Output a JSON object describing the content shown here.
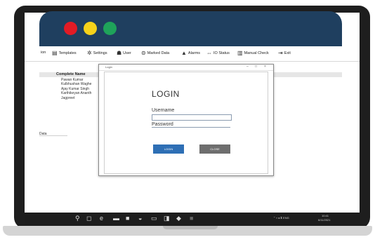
{
  "toolbar": {
    "items": [
      {
        "label": "ion",
        "icon": "app-icon"
      },
      {
        "label": "Templates",
        "icon": "templates-icon"
      },
      {
        "label": "Settings",
        "icon": "gear-icon"
      },
      {
        "label": "User",
        "icon": "users-icon"
      },
      {
        "label": "Marked Data",
        "icon": "marked-data-icon"
      },
      {
        "label": "Alarms",
        "icon": "alarm-bell-icon"
      },
      {
        "label": "IO Status",
        "icon": "io-status-icon"
      },
      {
        "label": "Manual Check",
        "icon": "manual-check-icon"
      },
      {
        "label": "Exit",
        "icon": "exit-icon"
      }
    ]
  },
  "list": {
    "header": "Complete Name",
    "items": [
      "Pawan Kumar",
      "Kulbhushan Waghe",
      "Ajay Kumar Singh",
      "Karthikeyan Ananth",
      "Jagpreet"
    ]
  },
  "side_label": "Data",
  "dialog": {
    "title": "Login",
    "heading": "LOGIN",
    "username_label": "Username",
    "username_value": "",
    "password_label": "Password",
    "password_value": "",
    "login_button": "LOGIN",
    "close_button": "CLOSE"
  },
  "taskbar": {
    "time": "10:41",
    "date": "6/11/2021"
  },
  "colors": {
    "banner": "#1f3f5f",
    "dot_red": "#e21b25",
    "dot_yellow": "#f6d21a",
    "dot_green": "#1fa35a",
    "login_button": "#2e6fb5",
    "close_button": "#6e6e6e"
  }
}
